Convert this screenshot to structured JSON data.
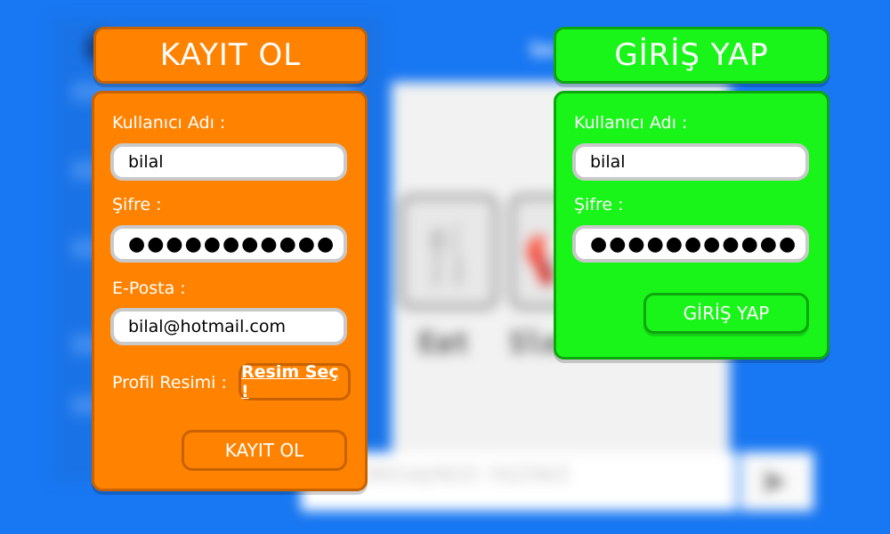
{
  "background": {
    "top_label": "be",
    "tiles": [
      {
        "icon": "fork-knife-icon",
        "label": "Eat"
      },
      {
        "icon": "megaphone-icon",
        "label": "Sle"
      }
    ],
    "message_placeholder": "MESAJINIZI YAZINIZ",
    "send_icon": "send-icon"
  },
  "register": {
    "title": "KAYIT OL",
    "username_label": "Kullanıcı Adı :",
    "username_value": "bilal",
    "password_label": "Şifre :",
    "password_value": "●●●●●●●●●●●",
    "email_label": "E-Posta :",
    "email_value": "bilal@hotmail.com",
    "avatar_label": "Profil Resimi :",
    "choose_image_button": "Resim Seç !",
    "submit_button": "KAYIT OL"
  },
  "login": {
    "title": "GİRİŞ YAP",
    "username_label": "Kullanıcı Adı :",
    "username_value": "bilal",
    "password_label": "Şifre :",
    "password_value": "●●●●●●●●●●●",
    "submit_button": "GİRİŞ YAP"
  },
  "colors": {
    "background": "#1877f2",
    "register_accent": "#ff8200",
    "login_accent": "#19f519"
  }
}
